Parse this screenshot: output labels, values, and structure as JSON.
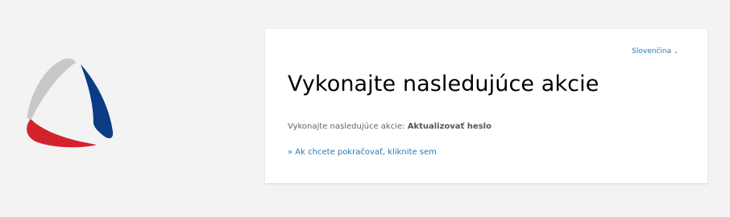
{
  "language": {
    "selected": "Slovenčina",
    "chevron_icon": "chevron-down-icon"
  },
  "page": {
    "title": "Vykonajte nasledujúce akcie",
    "instruction_prefix": "Vykonajte nasledujúce akcie:",
    "required_action": "Aktualizovať heslo",
    "continue_link": "» Ak chcete pokračovať, kliknite sem"
  },
  "logo": {
    "colors": {
      "gray": "#c8c8ca",
      "blue": "#0b3b85",
      "red": "#d4222d"
    }
  },
  "colors": {
    "background": "#f3f3f3",
    "card": "#ffffff",
    "link": "#2a7ab3",
    "muted_text": "#666666"
  }
}
